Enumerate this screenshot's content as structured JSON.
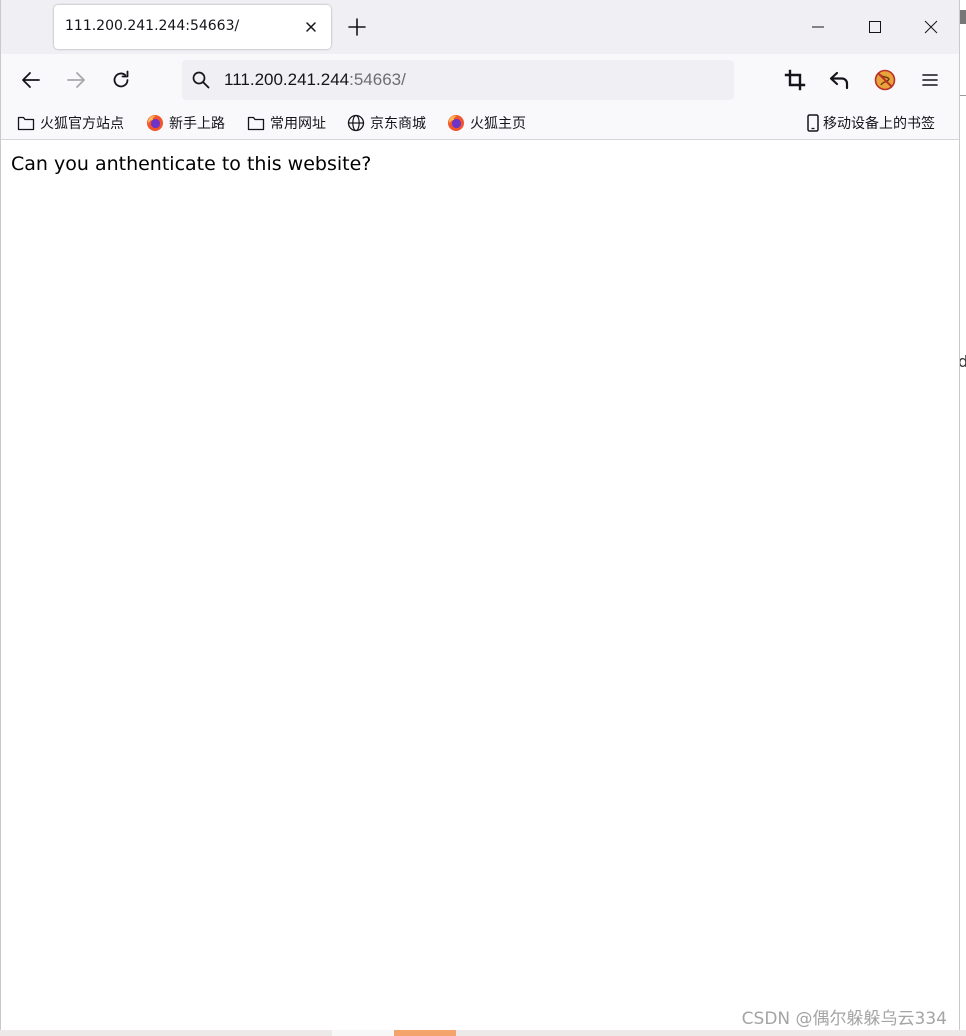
{
  "tab": {
    "title": "111.200.241.244:54663/"
  },
  "urlbar": {
    "host": "111.200.241.244",
    "rest": ":54663/"
  },
  "bookmarks": {
    "items": [
      {
        "label": "火狐官方站点",
        "icon": "folder-icon"
      },
      {
        "label": "新手上路",
        "icon": "firefox-icon"
      },
      {
        "label": "常用网址",
        "icon": "folder-icon"
      },
      {
        "label": "京东商城",
        "icon": "globe-icon"
      },
      {
        "label": "火狐主页",
        "icon": "firefox-icon"
      }
    ],
    "mobile_label": "移动设备上的书签"
  },
  "content": {
    "text": "Can you anthenticate to this website?"
  },
  "watermark": "CSDN @偶尔躲躲乌云334",
  "colors": {
    "tabstrip": "#f0f0f4",
    "toolbar": "#f9f9fb",
    "urlbar": "#f0f0f4",
    "text": "#15141a",
    "muted": "#6e6d75"
  }
}
